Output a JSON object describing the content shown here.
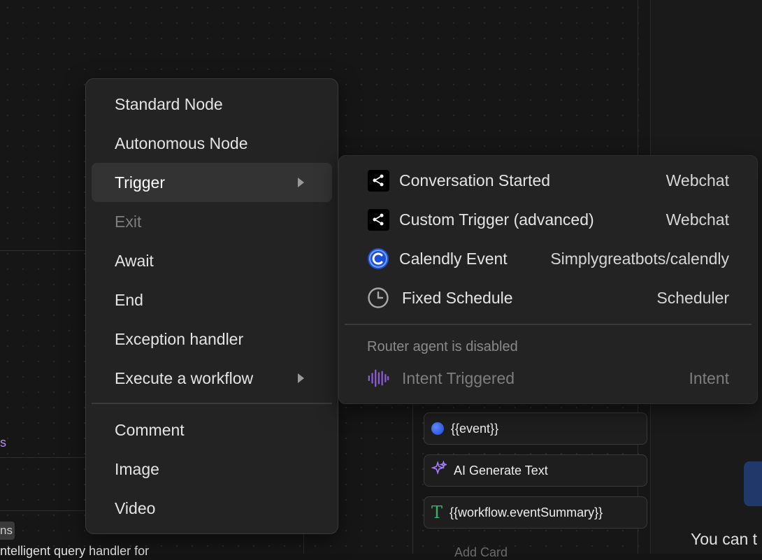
{
  "context_menu": {
    "items": [
      {
        "label": "Standard Node",
        "state": "normal"
      },
      {
        "label": "Autonomous Node",
        "state": "normal"
      },
      {
        "label": "Trigger",
        "state": "active",
        "has_submenu": true
      },
      {
        "label": "Exit",
        "state": "disabled"
      },
      {
        "label": "Await",
        "state": "normal"
      },
      {
        "label": "End",
        "state": "normal"
      },
      {
        "label": "Exception handler",
        "state": "normal"
      },
      {
        "label": "Execute a workflow",
        "state": "normal",
        "has_submenu": true
      }
    ],
    "secondary_items": [
      {
        "label": "Comment"
      },
      {
        "label": "Image"
      },
      {
        "label": "Video"
      }
    ]
  },
  "trigger_submenu": {
    "items": [
      {
        "label": "Conversation Started",
        "meta": "Webchat",
        "icon": "share-icon"
      },
      {
        "label": "Custom Trigger (advanced)",
        "meta": "Webchat",
        "icon": "share-icon"
      },
      {
        "label": "Calendly Event",
        "meta": "Simplygreatbots/calendly",
        "icon": "calendly-icon"
      },
      {
        "label": "Fixed Schedule",
        "meta": "Scheduler",
        "icon": "clock-icon"
      }
    ],
    "disabled_note": "Router agent is disabled",
    "disabled_item": {
      "label": "Intent Triggered",
      "meta": "Intent",
      "icon": "waveform-icon"
    }
  },
  "background": {
    "cards": [
      {
        "text": "{{event}}",
        "icon": "blue-dot-icon"
      },
      {
        "text": "AI Generate Text",
        "icon": "sparkle-icon"
      },
      {
        "text": "{{workflow.eventSummary}}",
        "icon": "text-icon"
      }
    ],
    "add_card_label": "Add Card",
    "left_partial_label": "s",
    "left_partial_tag": "ns",
    "left_partial_desc": "ntelligent query handler for",
    "right_partial_text": "You can t"
  },
  "colors": {
    "accent_purple": "#a77bff",
    "calendly_blue": "#2f6bff",
    "text_green": "#39b36a"
  }
}
